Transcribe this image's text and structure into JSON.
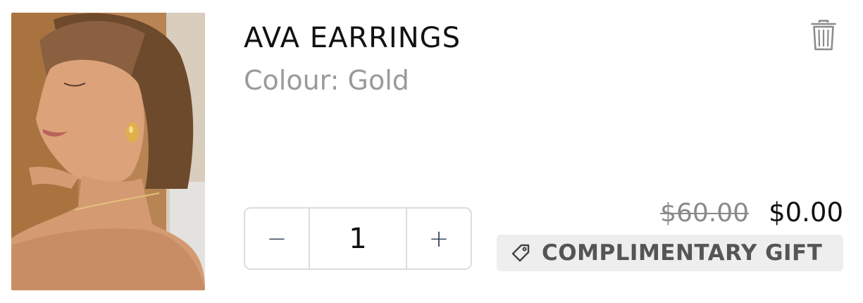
{
  "product": {
    "title": "AVA EARRINGS",
    "variant": "Colour: Gold",
    "image_icon": "product-photo-earrings-model"
  },
  "quantity": {
    "value": "1",
    "minus_label": "−",
    "plus_label": "+"
  },
  "pricing": {
    "original_price": "$60.00",
    "sale_price": "$0.00"
  },
  "badge": {
    "label": "COMPLIMENTARY GIFT",
    "icon": "tag-icon"
  },
  "actions": {
    "delete_icon": "trash-icon"
  },
  "colors": {
    "badge_background": "#eeeeee",
    "muted_text": "#9a9a9a",
    "stepper_border": "#dcdcdc"
  }
}
